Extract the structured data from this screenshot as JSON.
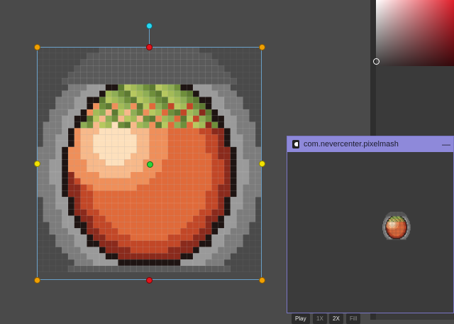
{
  "preview_window": {
    "title": "com.nevercenter.pixelmash",
    "minimize_symbol": "—",
    "buttons": {
      "play": "Play",
      "one_x": "1X",
      "two_x": "2X",
      "fill": "Fill"
    }
  },
  "color_picker": {
    "hue_color": "#e0202c"
  },
  "canvas": {
    "handle_colors": {
      "corner": "#f0a000",
      "edge": "#f2e200",
      "anchor": "#e3131b",
      "rotate": "#27d8f0",
      "center": "#2ad43a"
    }
  }
}
